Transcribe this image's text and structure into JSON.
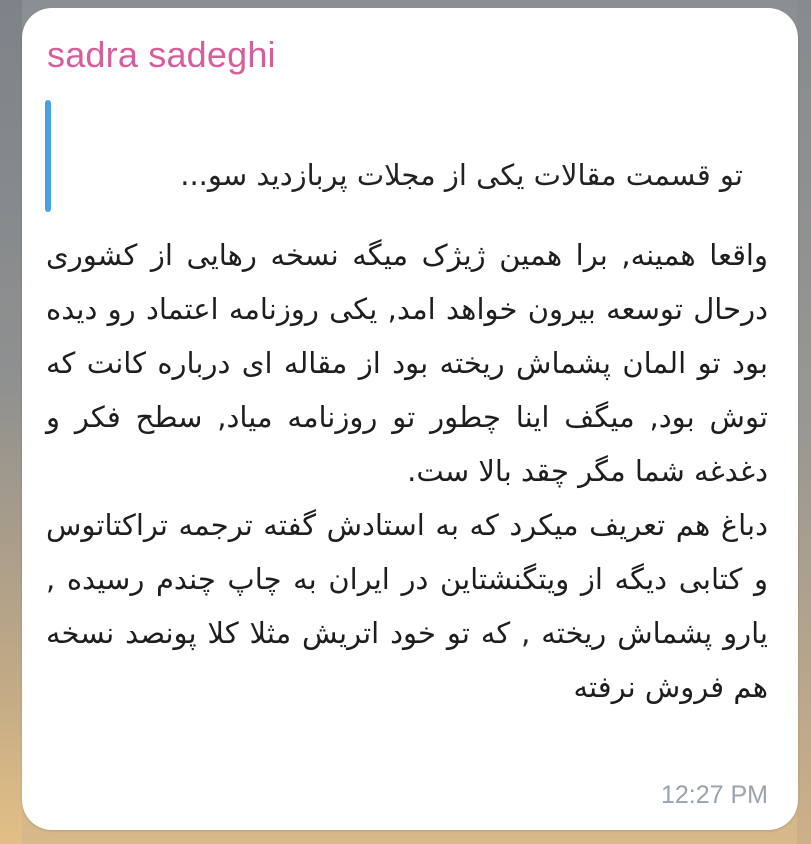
{
  "message": {
    "sender": "sadra sadeghi",
    "reply_preview": "تو قسمت مقالات یکی از مجلات پربازدید سو...",
    "paragraph_1": "واقعا همینه, برا همین ژیژک میگه نسخه رهایی از کشوری درحال توسعه بیرون خواهد امد, یکی روزنامه اعتماد رو دیده بود تو المان پشماش ریخته بود از مقاله ای درباره کانت که توش بود, میگف اینا چطور تو روزنامه میاد, سطح فکر و دغدغه شما مگر چقد بالا ست.",
    "paragraph_2": "دباغ هم تعریف میکرد که به استادش گفته ترجمه تراکتاتوس و کتابی دیگه از ویتگنشتاین در ایران به چاپ چندم رسیده , یارو پشماش ریخته , که تو خود اتریش مثلا کلا پونصد نسخه هم فروش نرفته",
    "time": "12:27 PM"
  },
  "colors": {
    "sender_name": "#d55f9b",
    "reply_bar": "#4ba2e0",
    "timestamp": "#9aa3ab",
    "bubble": "#ffffff"
  }
}
